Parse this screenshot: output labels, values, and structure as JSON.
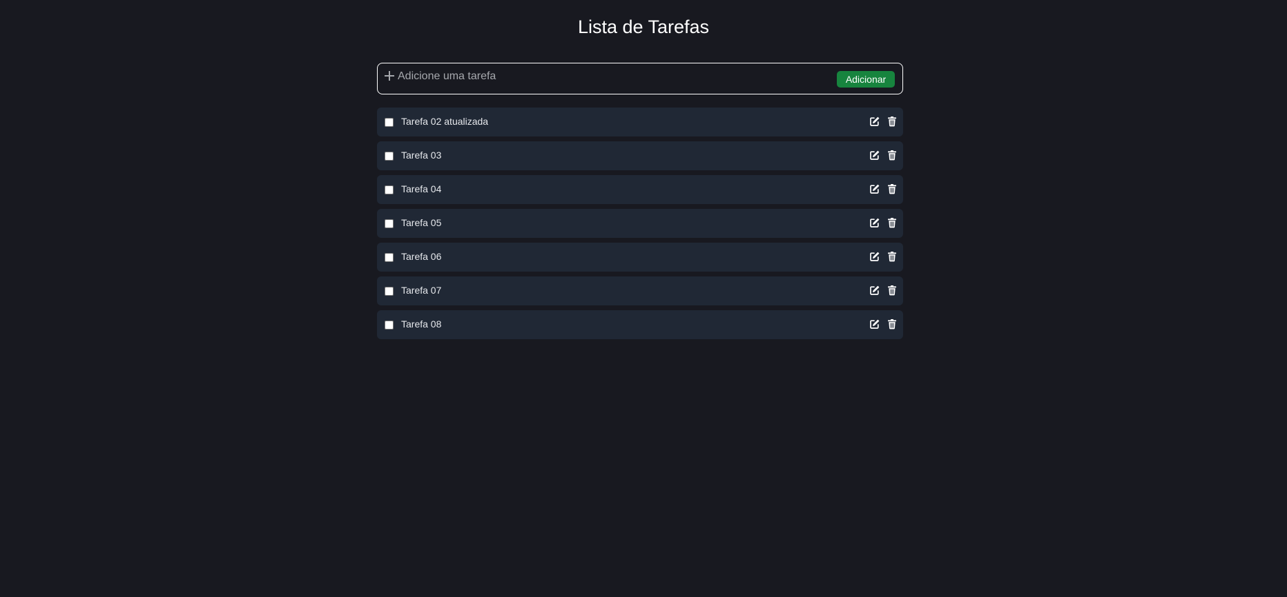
{
  "page": {
    "title": "Lista de Tarefas"
  },
  "add_bar": {
    "icon": "plus-icon",
    "input_value": "",
    "placeholder": "Adicione uma tarefa",
    "button_label": "Adicionar"
  },
  "tasks": [
    {
      "label": "Tarefa 02 atualizada",
      "checked": false
    },
    {
      "label": "Tarefa 03",
      "checked": false
    },
    {
      "label": "Tarefa 04",
      "checked": false
    },
    {
      "label": "Tarefa 05",
      "checked": false
    },
    {
      "label": "Tarefa 06",
      "checked": false
    },
    {
      "label": "Tarefa 07",
      "checked": false
    },
    {
      "label": "Tarefa 08",
      "checked": false
    }
  ],
  "task_actions": {
    "edit_icon": "edit-icon",
    "delete_icon": "trash-icon"
  },
  "colors": {
    "background": "#181920",
    "row_background": "#202835",
    "accent_button": "#17843e",
    "text": "#ffffff"
  }
}
